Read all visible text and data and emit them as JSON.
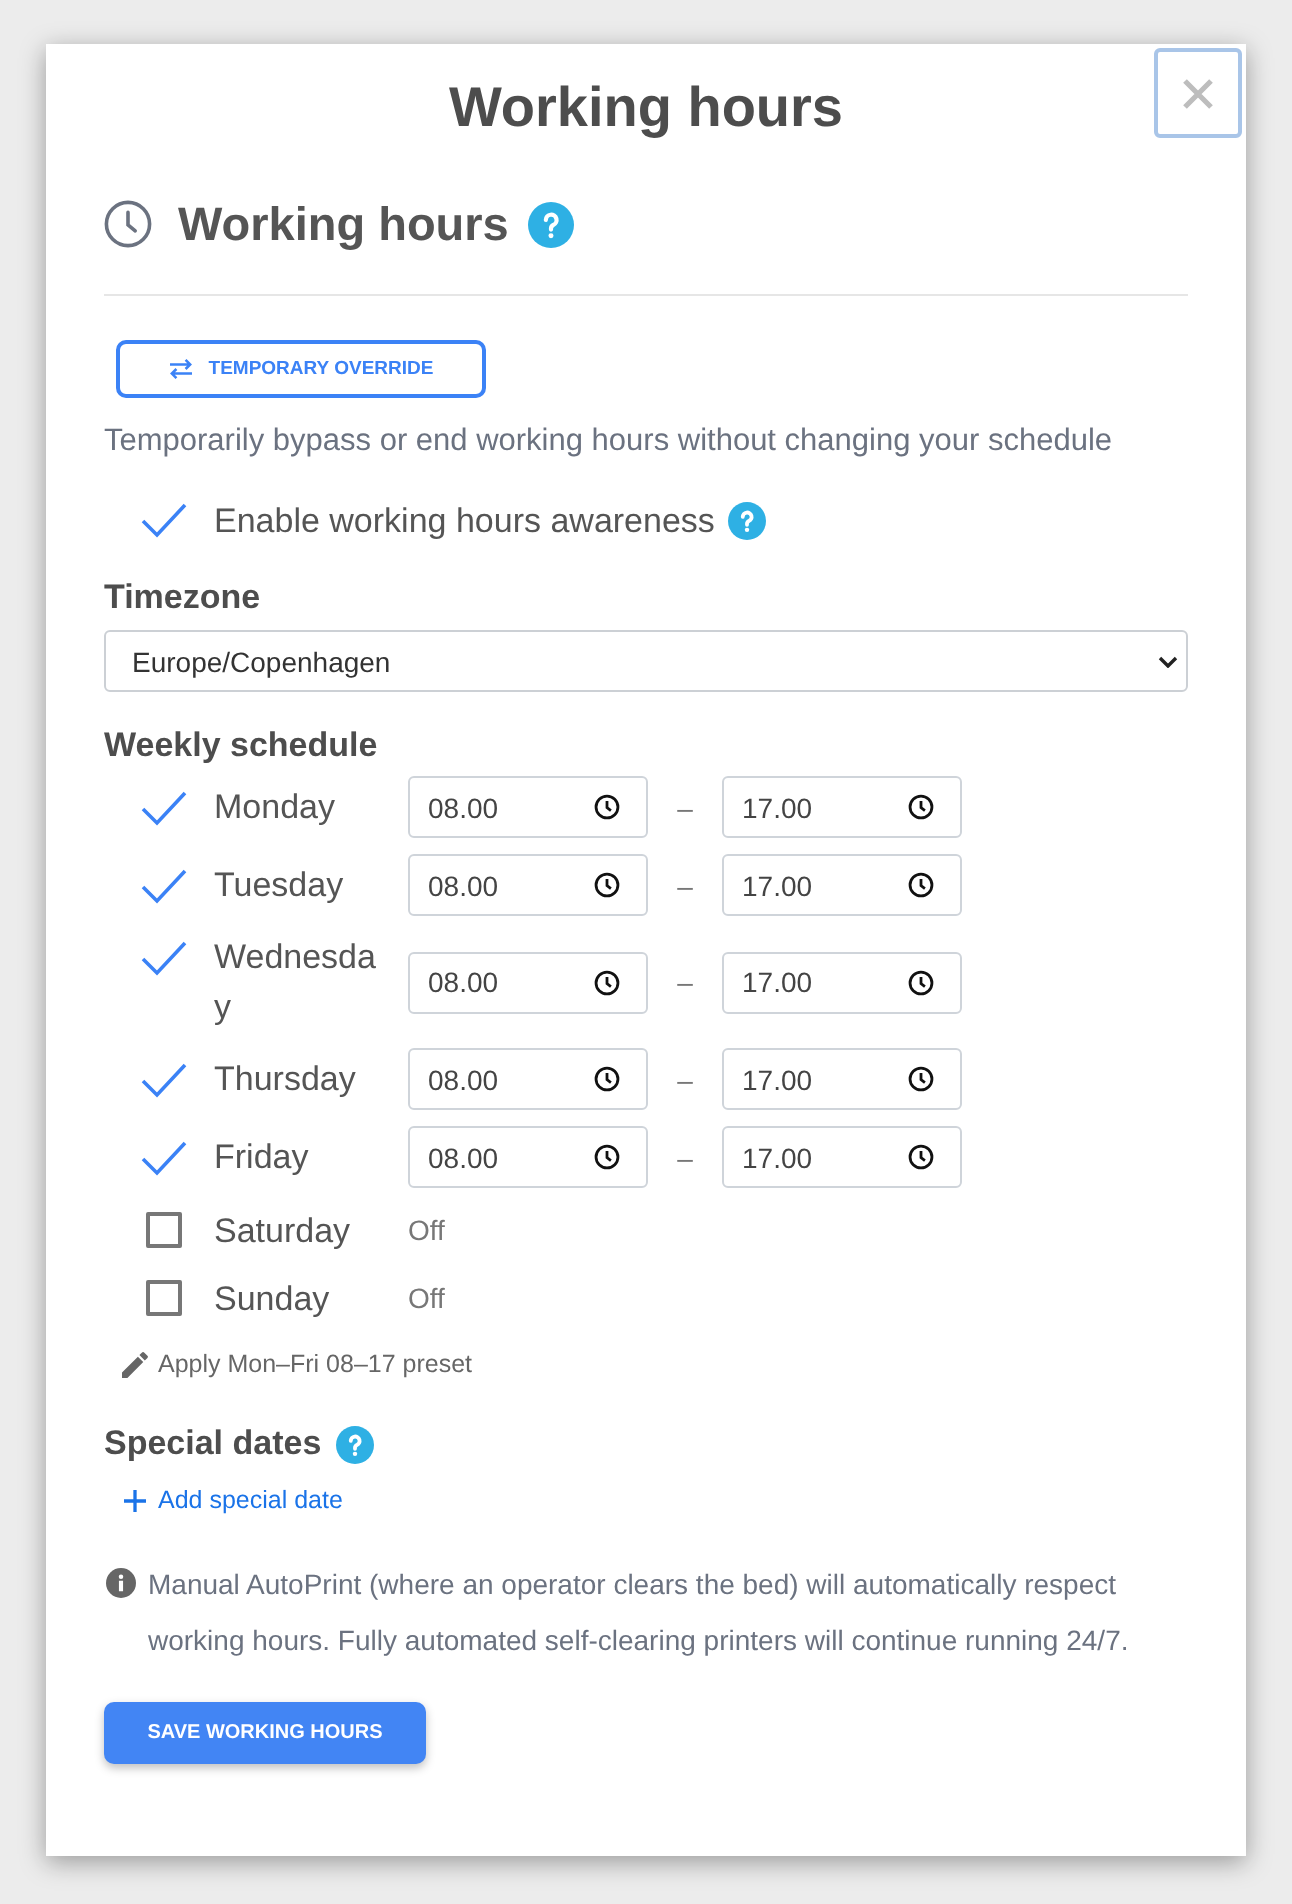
{
  "dialog": {
    "title": "Working hours"
  },
  "section": {
    "title": "Working hours"
  },
  "override_button": {
    "label": "TEMPORARY OVERRIDE"
  },
  "override_hint": "Temporarily bypass or end working hours without changing your schedule",
  "awareness": {
    "label": "Enable working hours awareness",
    "checked": true
  },
  "timezone": {
    "label": "Timezone",
    "value": "Europe/Copenhagen"
  },
  "schedule": {
    "title": "Weekly schedule",
    "days": [
      {
        "name": "Monday",
        "checked": true,
        "start": "08.00",
        "separator": "–",
        "end": "17.00"
      },
      {
        "name": "Tuesday",
        "checked": true,
        "start": "08.00",
        "separator": "–",
        "end": "17.00"
      },
      {
        "name": "Wednesday",
        "checked": true,
        "start": "08.00",
        "separator": "–",
        "end": "17.00"
      },
      {
        "name": "Thursday",
        "checked": true,
        "start": "08.00",
        "separator": "–",
        "end": "17.00"
      },
      {
        "name": "Friday",
        "checked": true,
        "start": "08.00",
        "separator": "–",
        "end": "17.00"
      },
      {
        "name": "Saturday",
        "checked": false,
        "status": "Off"
      },
      {
        "name": "Sunday",
        "checked": false,
        "status": "Off"
      }
    ]
  },
  "preset_link": "Apply Mon–Fri 08–17 preset",
  "special_dates": {
    "title": "Special dates",
    "add_link": "Add special date"
  },
  "note": "Manual AutoPrint (where an operator clears the bed) will automatically respect working hours. Fully automated self-clearing printers will continue running 24/7.",
  "save_button": "SAVE WORKING HOURS"
}
